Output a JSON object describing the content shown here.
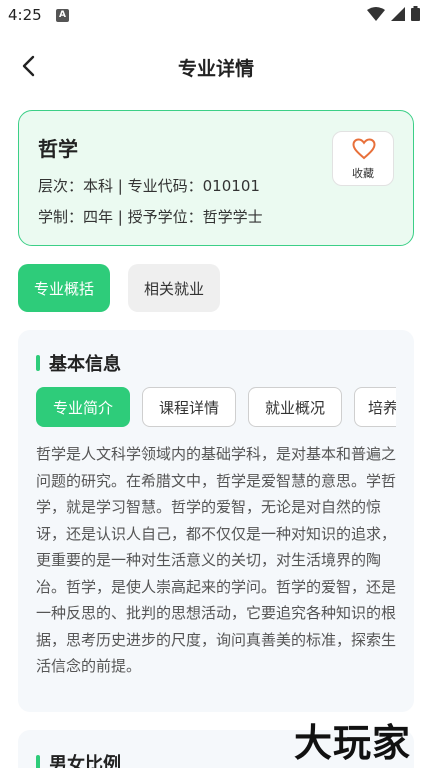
{
  "status_bar": {
    "time": "4:25",
    "app_icon_letter": "A"
  },
  "nav": {
    "title": "专业详情"
  },
  "major": {
    "name": "哲学",
    "level_label": "层次：",
    "level_value": "本科",
    "code_label": "专业代码：",
    "code_value": "010101",
    "duration_label": "学制：",
    "duration_value": "四年",
    "degree_label": "授予学位：",
    "degree_value": "哲学学士",
    "separator": " | ",
    "favorite_label": "收藏"
  },
  "main_tabs": [
    {
      "label": "专业概括",
      "active": true
    },
    {
      "label": "相关就业",
      "active": false
    }
  ],
  "basic_info": {
    "title": "基本信息",
    "subtabs": [
      "专业简介",
      "课程详情",
      "就业概况",
      "培养"
    ],
    "intro": "哲学是人文科学领域内的基础学科，是对基本和普遍之问题的研究。在希腊文中，哲学是爱智慧的意思。学哲学，就是学习智慧。哲学的爱智，无论是对自然的惊讶，还是认识人自己，都不仅仅是一种对知识的追求，更重要的是一种对生活意义的关切，对生活境界的陶冶。哲学，是使人崇高起来的学问。哲学的爱智，还是一种反思的、批判的思想活动，它要追究各种知识的根据，思考历史进步的尺度，询问真善美的标准，探索生活信念的前提。"
  },
  "gender_section": {
    "title": "男女比例"
  },
  "watermark": {
    "text": "大玩家"
  },
  "colors": {
    "accent": "#2ecc7a",
    "card_bg": "#ebfaf1",
    "heart": "#e8703a"
  }
}
